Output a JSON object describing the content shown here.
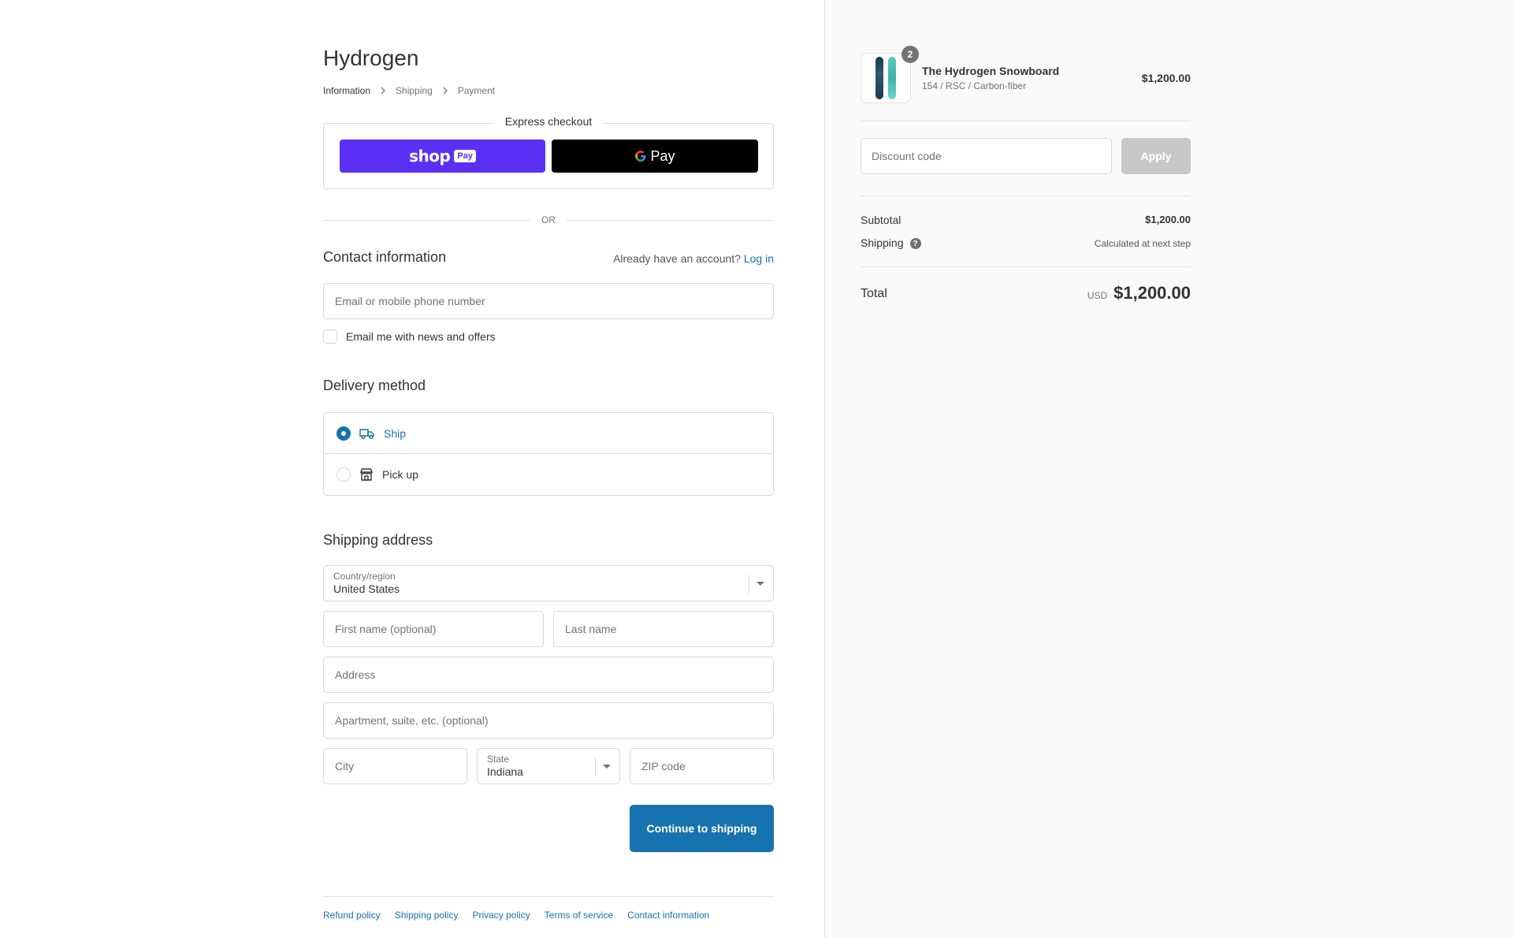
{
  "store": {
    "name": "Hydrogen"
  },
  "breadcrumb": [
    "Information",
    "Shipping",
    "Payment"
  ],
  "express": {
    "legend": "Express checkout",
    "shop_label": "shop",
    "pay_label": "Pay",
    "gpay_label": "Pay",
    "or_label": "OR"
  },
  "contact": {
    "title": "Contact information",
    "account_prompt": "Already have an account?",
    "login_label": "Log in",
    "email_placeholder": "Email or mobile phone number",
    "newsletter_label": "Email me with news and offers"
  },
  "delivery": {
    "title": "Delivery method",
    "options": [
      {
        "label": "Ship",
        "selected": true,
        "icon": "truck-icon"
      },
      {
        "label": "Pick up",
        "selected": false,
        "icon": "store-icon"
      }
    ]
  },
  "shipping_address": {
    "title": "Shipping address",
    "country_label": "Country/region",
    "country_value": "United States",
    "first_name_placeholder": "First name (optional)",
    "last_name_placeholder": "Last name",
    "address_placeholder": "Address",
    "apartment_placeholder": "Apartment, suite, etc. (optional)",
    "city_placeholder": "City",
    "state_label": "State",
    "state_value": "Indiana",
    "zip_placeholder": "ZIP code"
  },
  "continue_label": "Continue to shipping",
  "footer_links": [
    "Refund policy",
    "Shipping policy",
    "Privacy policy",
    "Terms of service",
    "Contact information"
  ],
  "summary": {
    "product": {
      "name": "The Hydrogen Snowboard",
      "variant": "154 / RSC / Carbon-fiber",
      "price": "$1,200.00",
      "quantity": "2"
    },
    "discount_placeholder": "Discount code",
    "apply_label": "Apply",
    "subtotal_label": "Subtotal",
    "subtotal_value": "$1,200.00",
    "shipping_label": "Shipping",
    "shipping_value": "Calculated at next step",
    "total_label": "Total",
    "currency": "USD",
    "total_value": "$1,200.00"
  },
  "colors": {
    "accent": "#1773b0",
    "shop_pay": "#5a31f4",
    "gpay": "#000000",
    "apply_disabled": "#c8c8c8"
  }
}
